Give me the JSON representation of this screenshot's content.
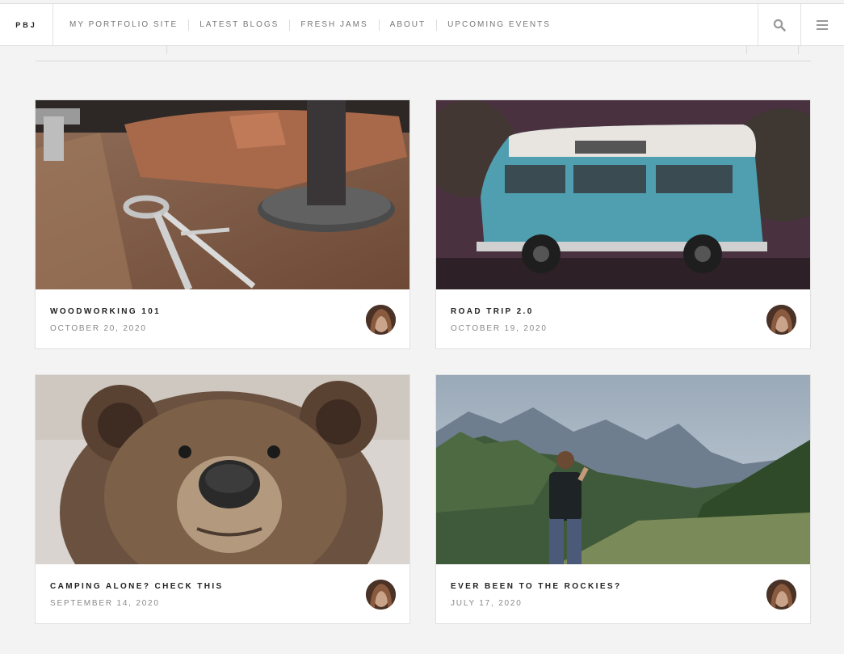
{
  "brand": "PBJ",
  "nav": [
    {
      "label": "MY PORTFOLIO SITE"
    },
    {
      "label": "LATEST BLOGS"
    },
    {
      "label": "FRESH JAMS"
    },
    {
      "label": "ABOUT"
    },
    {
      "label": "UPCOMING EVENTS"
    }
  ],
  "icons": {
    "search": "search-icon",
    "menu": "menu-icon"
  },
  "posts": [
    {
      "title": "WOODWORKING 101",
      "date": "OCTOBER 20, 2020",
      "image": "woodworking-tools-photo"
    },
    {
      "title": "ROAD TRIP 2.0",
      "date": "OCTOBER 19, 2020",
      "image": "blue-vw-van-photo"
    },
    {
      "title": "CAMPING ALONE? CHECK THIS",
      "date": "SEPTEMBER 14, 2020",
      "image": "brown-bear-photo"
    },
    {
      "title": "EVER BEEN TO THE ROCKIES?",
      "date": "JULY 17, 2020",
      "image": "mountain-hiker-photo"
    }
  ],
  "colors": {
    "background": "#f3f3f3",
    "card": "#ffffff",
    "title": "#222222",
    "date": "#888888"
  }
}
